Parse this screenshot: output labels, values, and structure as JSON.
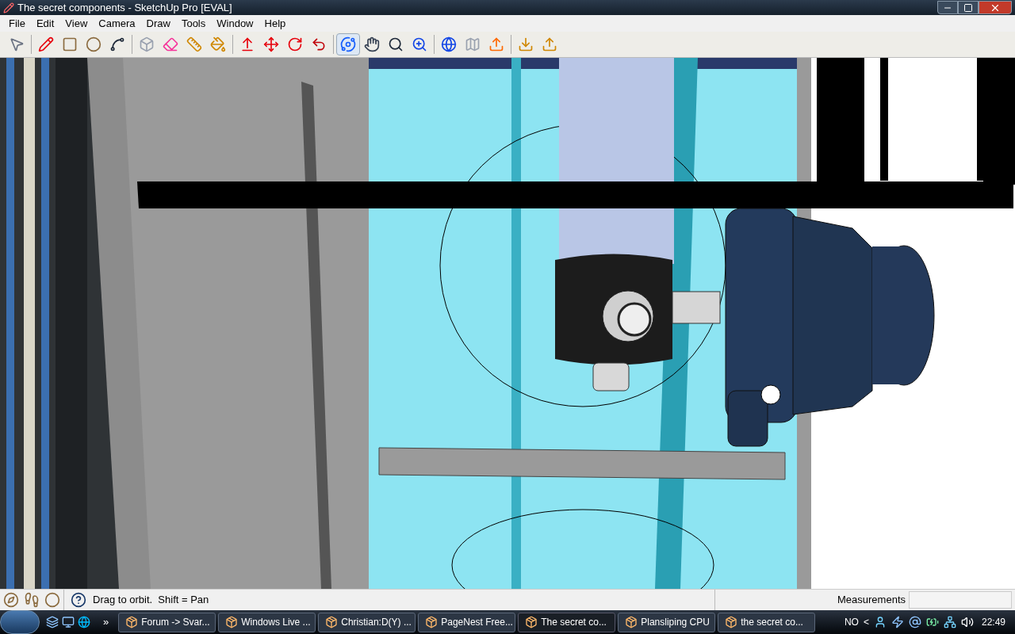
{
  "window": {
    "title": "The secret components - SketchUp Pro [EVAL]"
  },
  "menu": [
    "File",
    "Edit",
    "View",
    "Camera",
    "Draw",
    "Tools",
    "Window",
    "Help"
  ],
  "toolbar": {
    "tools": [
      {
        "selected": false
      },
      {
        "selected": false
      },
      {
        "selected": false
      },
      {
        "selected": false
      },
      {
        "selected": false
      },
      {
        "selected": false
      },
      {
        "selected": false
      },
      {
        "selected": false
      },
      {
        "selected": false
      },
      {
        "selected": false
      },
      {
        "selected": false
      },
      {
        "selected": false
      },
      {
        "selected": false
      },
      {
        "selected": true
      },
      {
        "selected": false
      },
      {
        "selected": false
      },
      {
        "selected": false
      },
      {
        "selected": false
      },
      {
        "selected": false
      },
      {
        "selected": false
      },
      {
        "selected": false
      },
      {
        "selected": false
      }
    ]
  },
  "status_bar": {
    "hint": "Drag to orbit.  Shift = Pan",
    "measurements_label": "Measurements"
  },
  "taskbar": {
    "overflow": "»",
    "tasks": [
      {
        "label": "Forum -> Svar...",
        "selected": false
      },
      {
        "label": "Windows Live ...",
        "selected": false
      },
      {
        "label": "Christian:D(Y) ...",
        "selected": false
      },
      {
        "label": "PageNest Free...",
        "selected": false
      },
      {
        "label": "The secret co...",
        "selected": true
      },
      {
        "label": "Plansliping CPU",
        "selected": false
      },
      {
        "label": "the secret co...",
        "selected": false
      }
    ],
    "language": "NO",
    "tray_expand": "<",
    "clock": "22:49"
  }
}
